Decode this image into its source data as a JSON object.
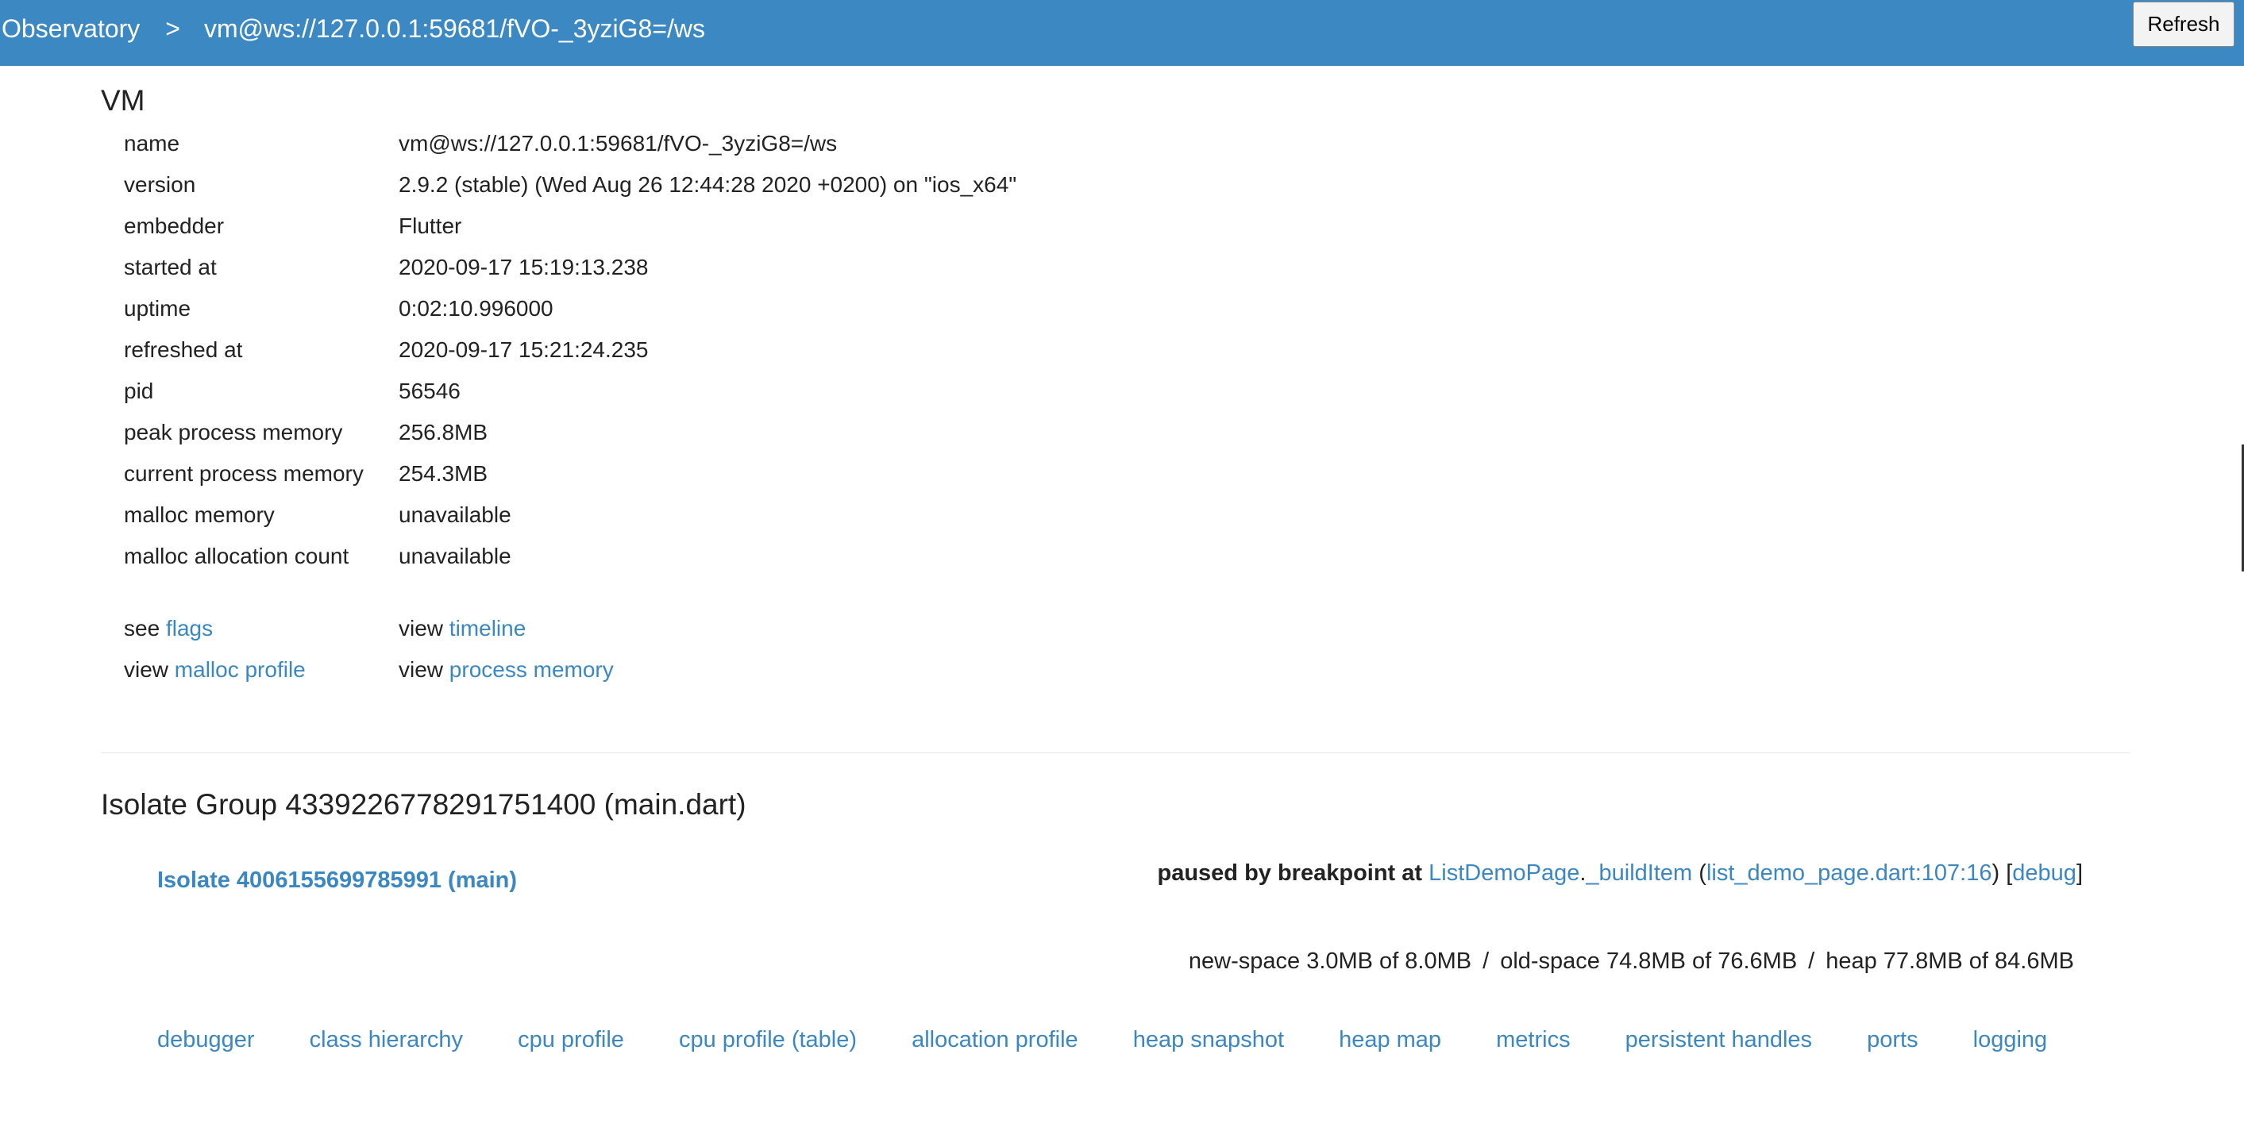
{
  "header": {
    "breadcrumb": [
      "Observatory",
      "vm@ws://127.0.0.1:59681/fVO-_3yziG8=/ws"
    ],
    "separator": ">",
    "refresh_label": "Refresh"
  },
  "vm": {
    "title": "VM",
    "properties": [
      {
        "label": "name",
        "value": "vm@ws://127.0.0.1:59681/fVO-_3yziG8=/ws"
      },
      {
        "label": "version",
        "value": "2.9.2 (stable) (Wed Aug 26 12:44:28 2020 +0200) on \"ios_x64\""
      },
      {
        "label": "embedder",
        "value": "Flutter"
      },
      {
        "label": "started at",
        "value": "2020-09-17 15:19:13.238"
      },
      {
        "label": "uptime",
        "value": "0:02:10.996000"
      },
      {
        "label": "refreshed at",
        "value": "2020-09-17 15:21:24.235"
      },
      {
        "label": "pid",
        "value": "56546"
      },
      {
        "label": "peak process memory",
        "value": "256.8MB"
      },
      {
        "label": "current process memory",
        "value": "254.3MB"
      },
      {
        "label": "malloc memory",
        "value": "unavailable"
      },
      {
        "label": "malloc allocation count",
        "value": "unavailable"
      }
    ],
    "links": {
      "see_prefix": "see",
      "view_prefix": "view",
      "flags": "flags",
      "timeline": "timeline",
      "malloc_profile": "malloc profile",
      "process_memory": "process memory"
    }
  },
  "isolate_group": {
    "title": "Isolate Group 4339226778291751400 (main.dart)",
    "isolate": {
      "name": "Isolate 4006155699785991 (main)",
      "pause": {
        "prefix": "paused by breakpoint at",
        "class_name": "ListDemoPage",
        "dot": ".",
        "function_name": "_buildItem",
        "open_paren": " (",
        "location": "list_demo_page.dart:107:16",
        "close_paren": ")",
        "open_bracket": " [",
        "debug": "debug",
        "close_bracket": "]"
      },
      "memory": {
        "new_space": "new-space 3.0MB of 8.0MB",
        "old_space": "old-space 74.8MB of 76.6MB",
        "heap": "heap 77.8MB of 84.6MB",
        "separator": "/"
      },
      "actions": [
        "debugger",
        "class hierarchy",
        "cpu profile",
        "cpu profile (table)",
        "allocation profile",
        "heap snapshot",
        "heap map",
        "metrics",
        "persistent handles",
        "ports",
        "logging"
      ]
    }
  }
}
